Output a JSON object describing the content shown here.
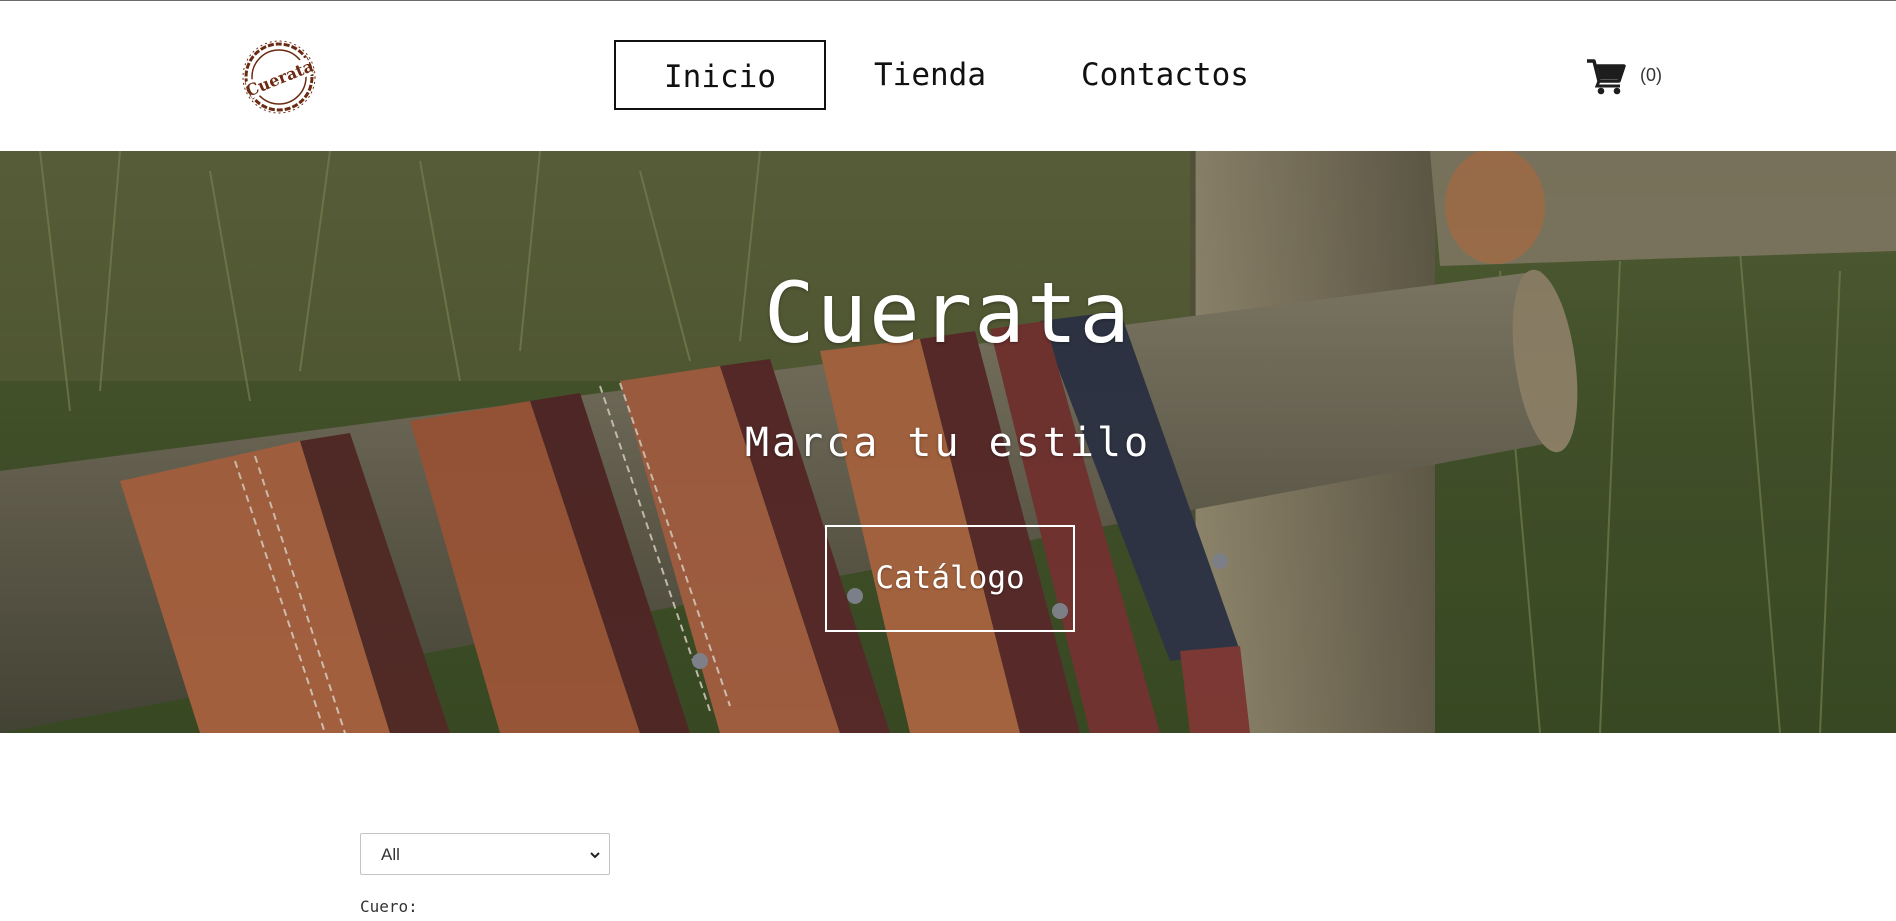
{
  "header": {
    "logo_text": "Cuerata",
    "nav": {
      "home": "Inicio",
      "shop": "Tienda",
      "contact": "Contactos"
    },
    "cart": {
      "icon": "cart-icon",
      "count": "(0)"
    }
  },
  "hero": {
    "title": "Cuerata",
    "subtitle": "Marca tu estilo",
    "button": "Catálogo"
  },
  "filter": {
    "selected": "All",
    "label": "Cuero:"
  },
  "colors": {
    "logo": "#6b2a12",
    "text": "#111111",
    "hero_text": "#ffffff"
  }
}
